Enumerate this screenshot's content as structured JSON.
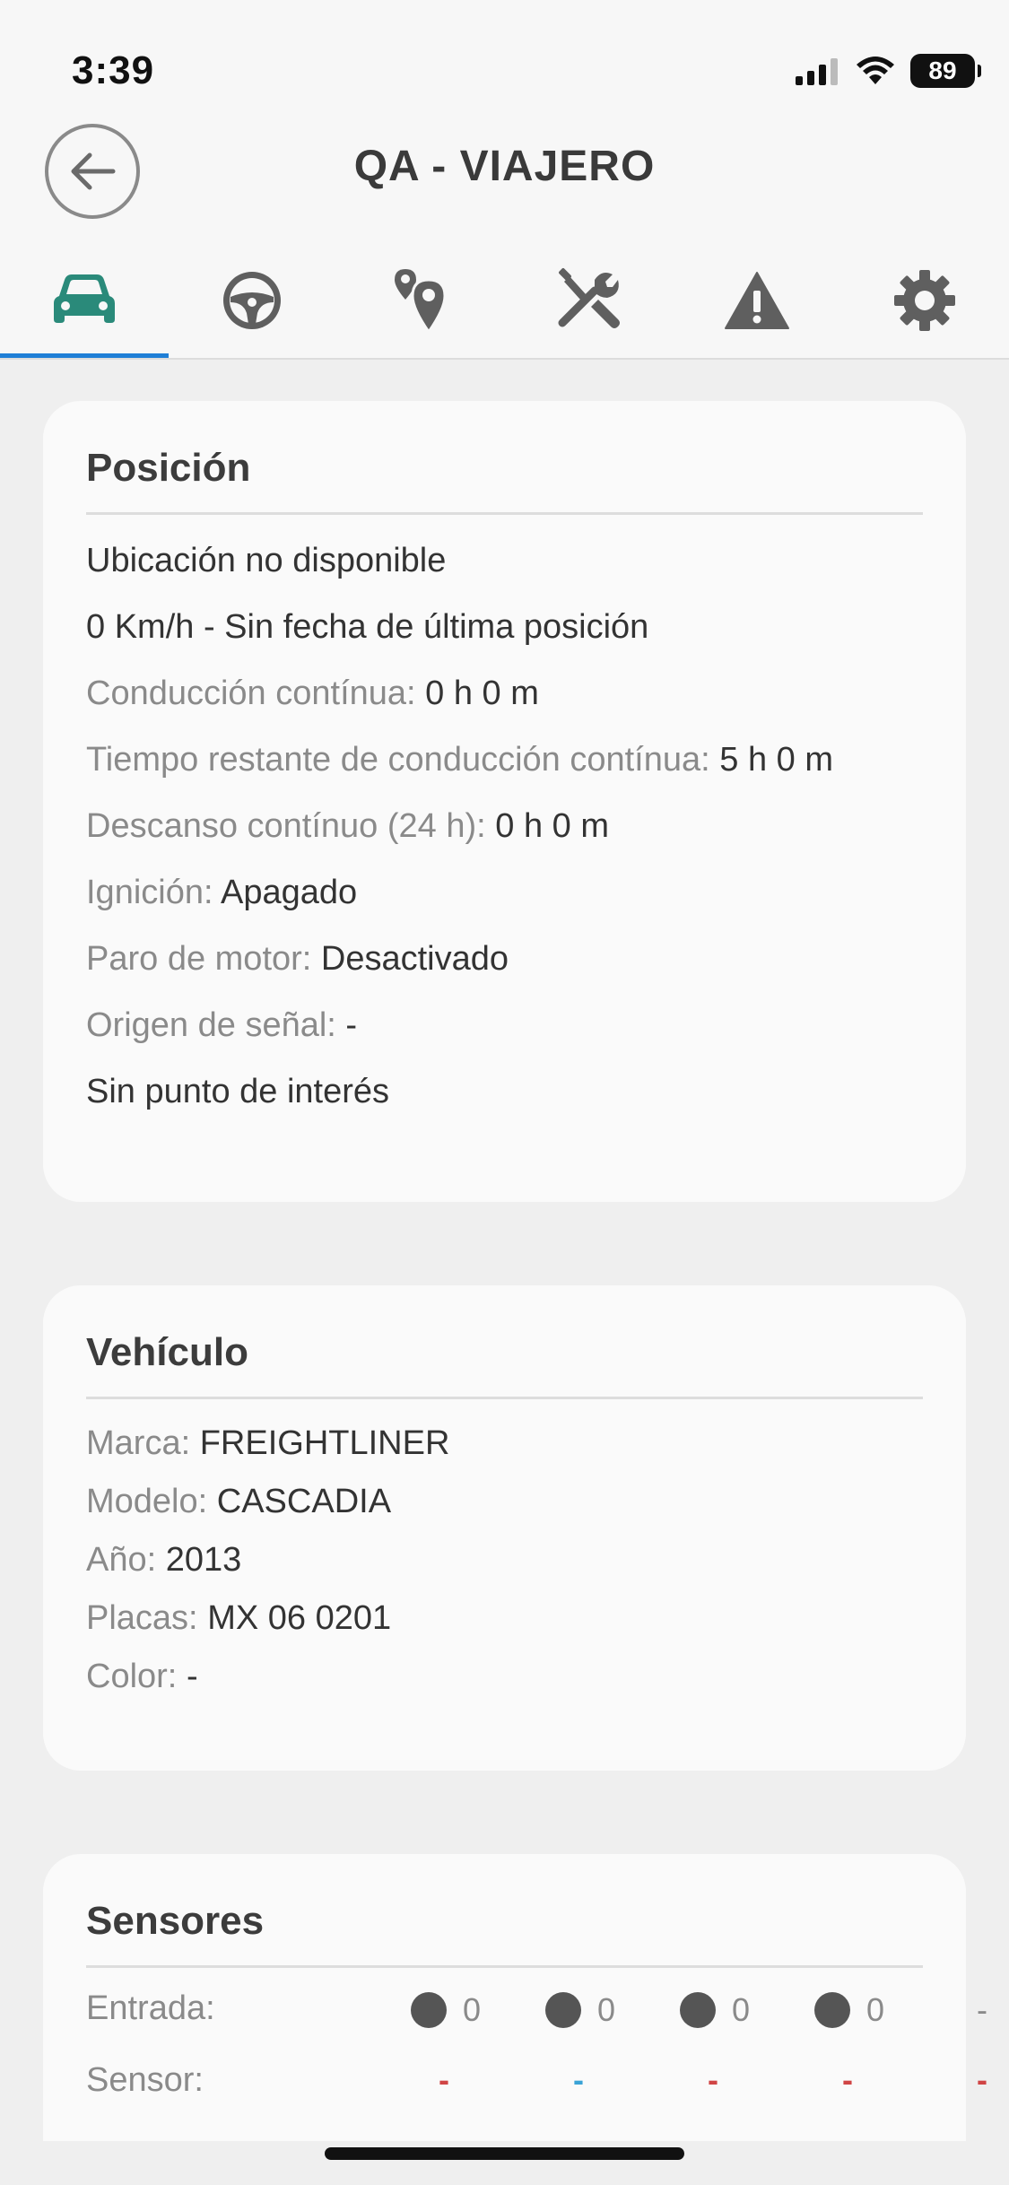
{
  "status_bar": {
    "time": "3:39",
    "battery": "89"
  },
  "header": {
    "title": "QA - VIAJERO"
  },
  "tabs": [
    {
      "icon": "car-icon",
      "active": true
    },
    {
      "icon": "steering-wheel-icon",
      "active": false
    },
    {
      "icon": "location-pins-icon",
      "active": false
    },
    {
      "icon": "tools-icon",
      "active": false
    },
    {
      "icon": "warning-icon",
      "active": false
    },
    {
      "icon": "gear-icon",
      "active": false
    }
  ],
  "colors": {
    "accent": "#1f7fd6",
    "car_icon": "#2a8a7a",
    "icon_gray": "#5f5f5f",
    "dash_red": "#d04545",
    "dash_blue": "#3aa3d6"
  },
  "position": {
    "title": "Posición",
    "location": "Ubicación no disponible",
    "speed_line": "0 Km/h - Sin fecha de última posición",
    "continuous_driving_label": "Conducción contínua:",
    "continuous_driving_value": "0 h 0 m",
    "remaining_label": "Tiempo restante de conducción contínua:",
    "remaining_value": "5 h 0 m",
    "rest_label": "Descanso contínuo (24 h):",
    "rest_value": "0 h 0 m",
    "ignition_label": "Ignición:",
    "ignition_value": "Apagado",
    "engine_stop_label": "Paro de motor:",
    "engine_stop_value": "Desactivado",
    "signal_label": "Origen de señal:",
    "signal_value": "-",
    "poi": "Sin punto de interés"
  },
  "vehicle": {
    "title": "Vehículo",
    "brand_label": "Marca:",
    "brand_value": "FREIGHTLINER",
    "model_label": "Modelo:",
    "model_value": "CASCADIA",
    "year_label": "Año:",
    "year_value": "2013",
    "plates_label": "Placas:",
    "plates_value": "MX 06 0201",
    "color_label": "Color:",
    "color_value": "-"
  },
  "sensors": {
    "title": "Sensores",
    "input_label": "Entrada:",
    "inputs": [
      "0",
      "0",
      "0",
      "0"
    ],
    "input_last": "-",
    "sensor_label": "Sensor:",
    "sensor_values": [
      "-",
      "-",
      "-",
      "-",
      "-"
    ]
  }
}
